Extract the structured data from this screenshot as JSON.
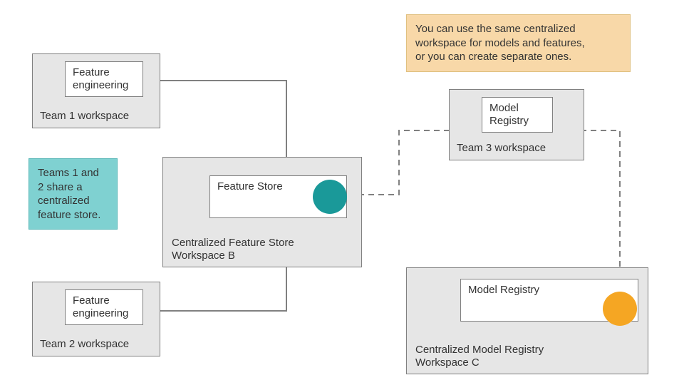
{
  "boxes": {
    "team1": {
      "label": "Team 1 workspace",
      "inner": "Feature\nengineering"
    },
    "team2": {
      "label": "Team 2 workspace",
      "inner": "Feature\nengineering"
    },
    "team3": {
      "label": "Team 3 workspace",
      "inner": "Model\nRegistry"
    },
    "central_fs": {
      "label_line1": "Centralized Feature Store",
      "label_line2": "Workspace B",
      "inner": "Feature Store"
    },
    "central_mr": {
      "label_line1": "Centralized Model Registry",
      "label_line2": "Workspace C",
      "inner": "Model Registry"
    }
  },
  "callouts": {
    "teal": "Teams 1 and\n2 share a\ncentralized\nfeature store.",
    "cream": "You can use the same centralized\nworkspace for models and features,\nor you can create separate ones."
  },
  "colors": {
    "teal_circle": "#1a9999",
    "orange_circle": "#f5a623",
    "arrow": "#808080",
    "box_bg": "#e6e6e6",
    "callout_teal": "#7fd1d1",
    "callout_cream": "#f8d8a8"
  }
}
